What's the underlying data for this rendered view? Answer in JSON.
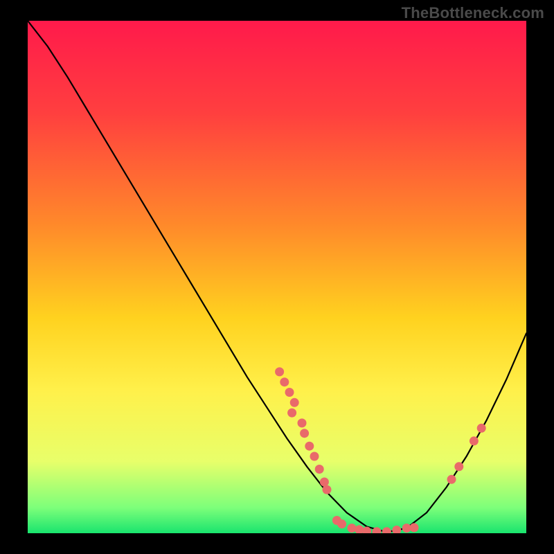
{
  "watermark": "TheBottleneck.com",
  "chart_data": {
    "type": "line",
    "title": "",
    "xlabel": "",
    "ylabel": "",
    "xlim": [
      0,
      100
    ],
    "ylim": [
      0,
      100
    ],
    "gradient_stops": [
      {
        "offset": 0,
        "color": "#ff1a4b"
      },
      {
        "offset": 18,
        "color": "#ff3f3f"
      },
      {
        "offset": 40,
        "color": "#ff8a2a"
      },
      {
        "offset": 58,
        "color": "#ffd21f"
      },
      {
        "offset": 72,
        "color": "#fff04a"
      },
      {
        "offset": 86,
        "color": "#e8ff6a"
      },
      {
        "offset": 95,
        "color": "#7dff7a"
      },
      {
        "offset": 100,
        "color": "#19e46e"
      }
    ],
    "curve": {
      "x": [
        0,
        4,
        8,
        12,
        16,
        20,
        24,
        28,
        32,
        36,
        40,
        44,
        48,
        52,
        56,
        60,
        64,
        68,
        72,
        76,
        80,
        84,
        88,
        92,
        96,
        100
      ],
      "y": [
        100,
        95,
        89,
        82.5,
        76,
        69.5,
        63,
        56.5,
        50,
        43.5,
        37,
        30.5,
        24.5,
        18.5,
        13,
        8,
        4,
        1.3,
        0.2,
        1,
        4,
        9,
        15,
        22,
        30,
        39
      ]
    },
    "dots": [
      {
        "x": 50.5,
        "y": 31.5
      },
      {
        "x": 51.5,
        "y": 29.5
      },
      {
        "x": 52.5,
        "y": 27.5
      },
      {
        "x": 53.5,
        "y": 25.5
      },
      {
        "x": 53.0,
        "y": 23.5
      },
      {
        "x": 55.0,
        "y": 21.5
      },
      {
        "x": 55.5,
        "y": 19.5
      },
      {
        "x": 56.5,
        "y": 17.0
      },
      {
        "x": 57.5,
        "y": 15.0
      },
      {
        "x": 58.5,
        "y": 12.5
      },
      {
        "x": 59.5,
        "y": 10.0
      },
      {
        "x": 60.0,
        "y": 8.5
      },
      {
        "x": 62.0,
        "y": 2.5
      },
      {
        "x": 63.0,
        "y": 1.8
      },
      {
        "x": 65.0,
        "y": 1.0
      },
      {
        "x": 66.5,
        "y": 0.7
      },
      {
        "x": 68.0,
        "y": 0.4
      },
      {
        "x": 70.0,
        "y": 0.3
      },
      {
        "x": 72.0,
        "y": 0.3
      },
      {
        "x": 74.0,
        "y": 0.6
      },
      {
        "x": 76.0,
        "y": 1.0
      },
      {
        "x": 77.5,
        "y": 1.1
      },
      {
        "x": 85.0,
        "y": 10.5
      },
      {
        "x": 86.5,
        "y": 13.0
      },
      {
        "x": 89.5,
        "y": 18.0
      },
      {
        "x": 91.0,
        "y": 20.5
      }
    ],
    "dot_color": "#e96a6a",
    "curve_color": "#000000"
  }
}
